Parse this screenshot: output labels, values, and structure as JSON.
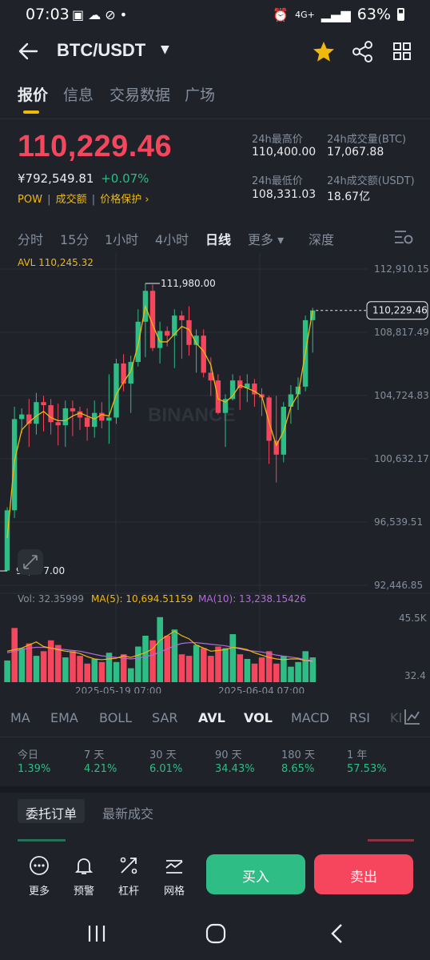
{
  "status": {
    "time": "07:03",
    "network": "4G+",
    "battery": "63%"
  },
  "header": {
    "pair": "BTC/USDT"
  },
  "tabs": [
    {
      "label": "报价"
    },
    {
      "label": "信息"
    },
    {
      "label": "交易数据"
    },
    {
      "label": "广场"
    }
  ],
  "ticker": {
    "price": "110,229.46",
    "cny": "¥792,549.81",
    "change": "+0.07%",
    "tag_pow": "POW",
    "tag_volume": "成交额",
    "tag_protect": "价格保护 ›",
    "high_label": "24h最高价",
    "high_value": "110,400.00",
    "low_label": "24h最低价",
    "low_value": "108,331.03",
    "vol_btc_label": "24h成交量(BTC)",
    "vol_btc_value": "17,067.88",
    "vol_usdt_label": "24h成交额(USDT)",
    "vol_usdt_value": "18.67亿"
  },
  "intervals": {
    "items": [
      "分时",
      "15分",
      "1小时",
      "4小时",
      "日线",
      "更多 ▾",
      "深度"
    ],
    "active": "日线"
  },
  "chart_data": {
    "type": "candlestick",
    "avl_label": "AVL 110,245.32",
    "y_ticks": [
      "112,910.15",
      "108,817.49",
      "104,724.83",
      "100,632.17",
      "96,539.51",
      "92,446.85"
    ],
    "y_values": [
      112910.15,
      108817.49,
      104724.83,
      100632.17,
      96539.51,
      92446.85
    ],
    "ylim": [
      92446.85,
      112910.15
    ],
    "current_price_label": "110,229.46",
    "current_price": 110229.46,
    "high_marker": "111,980.00",
    "high_value": 111980.0,
    "low_marker": "93,377.00",
    "low_value": 93377.0,
    "watermark": "BINANCE",
    "x_labels": [
      "2025-05-19 07:00",
      "2025-06-04 07:00"
    ],
    "candles": [
      [
        93400,
        97300,
        93377,
        97500
      ],
      [
        97300,
        103200,
        96800,
        104000
      ],
      [
        103200,
        103500,
        102300,
        103900
      ],
      [
        103500,
        102900,
        101400,
        104500
      ],
      [
        102900,
        104300,
        102200,
        104900
      ],
      [
        104300,
        104100,
        102400,
        104700
      ],
      [
        104100,
        103000,
        102200,
        104500
      ],
      [
        103000,
        102800,
        101500,
        104200
      ],
      [
        102800,
        103900,
        101400,
        104400
      ],
      [
        103900,
        103700,
        102100,
        104400
      ],
      [
        103700,
        103300,
        102500,
        104000
      ],
      [
        103300,
        102700,
        101800,
        103900
      ],
      [
        102700,
        103600,
        102000,
        104400
      ],
      [
        103600,
        103100,
        102600,
        104300
      ],
      [
        103100,
        103300,
        101600,
        106100
      ],
      [
        103300,
        106800,
        102900,
        107100
      ],
      [
        106800,
        105500,
        105000,
        107400
      ],
      [
        105500,
        106900,
        103600,
        107300
      ],
      [
        106900,
        109500,
        106600,
        110300
      ],
      [
        109500,
        111500,
        107200,
        111980
      ],
      [
        111500,
        107800,
        107600,
        111900
      ],
      [
        107800,
        108900,
        106800,
        109500
      ],
      [
        108900,
        108600,
        107900,
        109200
      ],
      [
        108600,
        109900,
        106500,
        110300
      ],
      [
        109900,
        109600,
        107100,
        110200
      ],
      [
        109600,
        108000,
        107300,
        110500
      ],
      [
        108000,
        108600,
        106200,
        109000
      ],
      [
        108600,
        106200,
        105900,
        109000
      ],
      [
        106200,
        105700,
        104700,
        107200
      ],
      [
        105700,
        103600,
        103500,
        106100
      ],
      [
        103600,
        104500,
        101400,
        104800
      ],
      [
        104500,
        105700,
        104400,
        106100
      ],
      [
        105700,
        105200,
        103800,
        106000
      ],
      [
        105200,
        105500,
        104300,
        106100
      ],
      [
        105500,
        104800,
        104000,
        105800
      ],
      [
        104800,
        104600,
        103400,
        105200
      ],
      [
        104600,
        101800,
        100300,
        104700
      ],
      [
        101800,
        100900,
        99100,
        104700
      ],
      [
        100900,
        104000,
        100400,
        104300
      ],
      [
        104000,
        104800,
        102900,
        105400
      ],
      [
        104800,
        105300,
        103800,
        105900
      ],
      [
        105300,
        109600,
        105000,
        109900
      ],
      [
        109600,
        110229.46,
        107500,
        110400
      ]
    ],
    "avl_line": [
      95500,
      100500,
      102500,
      103000,
      103400,
      103700,
      103300,
      103100,
      103100,
      103400,
      103600,
      103400,
      103200,
      103500,
      103400,
      104800,
      105600,
      106300,
      108000,
      110500,
      109300,
      108200,
      108200,
      108700,
      109200,
      109000,
      108100,
      107600,
      106700,
      104500,
      104300,
      104700,
      105400,
      105200,
      105000,
      104700,
      103000,
      101500,
      102400,
      104000,
      104800,
      107500,
      110229.46
    ],
    "volume": {
      "label": "Vol: 32.35999",
      "ma5_label": "MA(5): 10,694.51159",
      "ma10_label": "MA(10): 13,238.15426",
      "ylabels": [
        "45.5K",
        "32.4"
      ],
      "ylim": [
        0,
        45500
      ],
      "values": [
        14000,
        35000,
        22000,
        25000,
        17000,
        20000,
        27000,
        24000,
        16000,
        20000,
        17000,
        12000,
        15000,
        13000,
        19000,
        13000,
        18000,
        9000,
        23000,
        30000,
        27000,
        42000,
        30000,
        34000,
        18000,
        17000,
        24000,
        22000,
        17000,
        23000,
        22000,
        31000,
        18000,
        15000,
        12000,
        16000,
        20000,
        12000,
        17000,
        10000,
        13000,
        20000,
        16000
      ],
      "colors_up": [
        1,
        0,
        1,
        0,
        1,
        0,
        0,
        0,
        1,
        0,
        0,
        0,
        1,
        0,
        1,
        1,
        0,
        1,
        1,
        1,
        0,
        1,
        0,
        1,
        0,
        0,
        1,
        0,
        0,
        0,
        1,
        1,
        0,
        1,
        0,
        0,
        0,
        0,
        1,
        1,
        1,
        1,
        1
      ],
      "ma5": [
        20000,
        21000,
        22000,
        24000,
        26000,
        23000,
        22000,
        21000,
        20000,
        19500,
        18500,
        16500,
        15000,
        14500,
        15000,
        15500,
        17000,
        16000,
        17500,
        19000,
        21500,
        27000,
        30000,
        33000,
        30000,
        28000,
        24000,
        22000,
        20000,
        20500,
        21000,
        22500,
        22000,
        21000,
        19000,
        17500,
        16000,
        15000,
        14500,
        15000,
        15000,
        14000,
        13500
      ],
      "ma10": [
        19000,
        20000,
        21000,
        22000,
        22500,
        22500,
        22000,
        21500,
        21000,
        20500,
        20000,
        19000,
        18000,
        17000,
        16500,
        16000,
        15500,
        15000,
        15500,
        16500,
        17500,
        19500,
        21500,
        23500,
        25000,
        25500,
        25500,
        25000,
        24500,
        24000,
        23500,
        22500,
        21500,
        20500,
        20000,
        19500,
        18500,
        17500,
        16800,
        16200,
        15500,
        14500,
        14000
      ]
    }
  },
  "indicators": {
    "items": [
      "MA",
      "EMA",
      "BOLL",
      "SAR",
      "AVL",
      "VOL",
      "MACD",
      "RSI",
      "KDJ"
    ],
    "active": [
      "AVL",
      "VOL"
    ]
  },
  "performance": [
    {
      "label": "今日",
      "value": "1.39%"
    },
    {
      "label": "7 天",
      "value": "4.21%"
    },
    {
      "label": "30 天",
      "value": "6.01%"
    },
    {
      "label": "90 天",
      "value": "34.43%"
    },
    {
      "label": "180 天",
      "value": "8.65%"
    },
    {
      "label": "1 年",
      "value": "57.53%"
    }
  ],
  "order_tabs": {
    "orders": "委托订单",
    "trades": "最新成交"
  },
  "actions": {
    "more": "更多",
    "alert": "预警",
    "leverage": "杠杆",
    "grid": "网格",
    "buy": "买入",
    "sell": "卖出"
  },
  "colors": {
    "up": "#2ebd85",
    "down": "#f6465d",
    "accent": "#f0b90b",
    "bg": "#1f2229"
  }
}
